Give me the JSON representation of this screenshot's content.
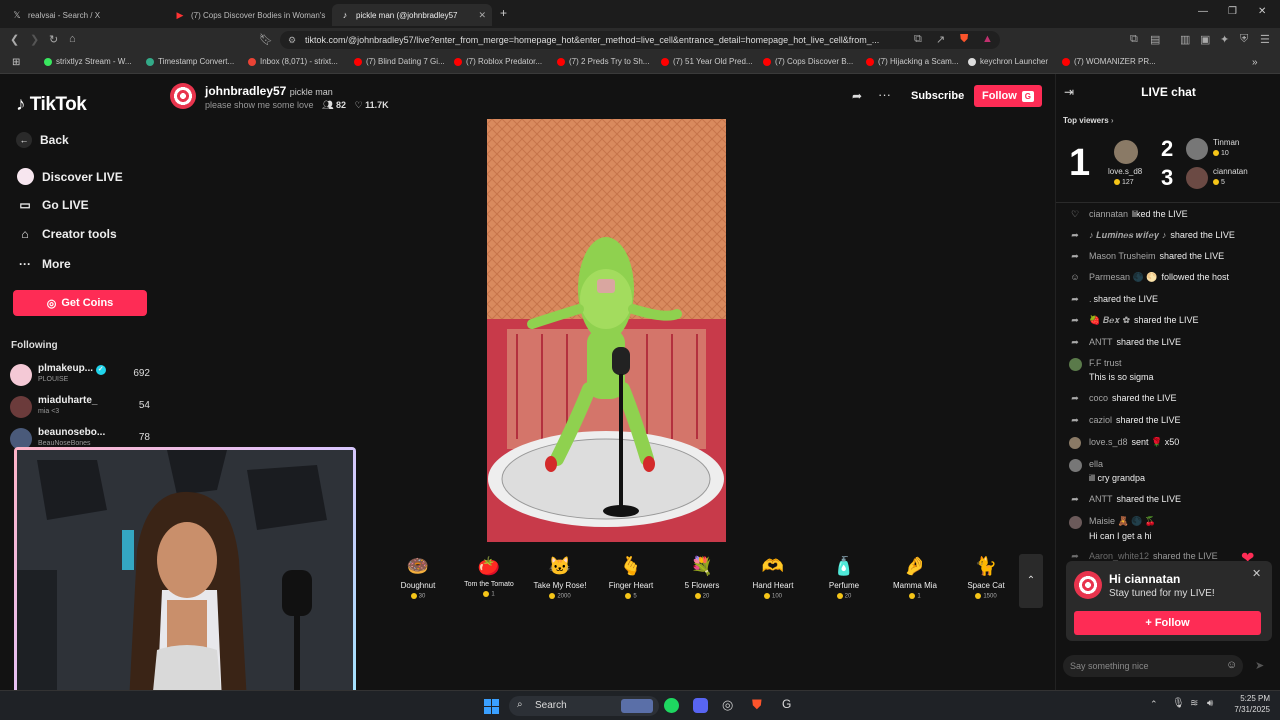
{
  "browser": {
    "tabs": [
      {
        "label": "realvsai - Search / X",
        "icon": "x-logo-icon"
      },
      {
        "label": "(7) Cops Discover Bodies in Woman's",
        "icon": "youtube-icon"
      },
      {
        "label": "pickle man (@johnbradley57",
        "icon": "tiktok-icon",
        "active": true
      }
    ],
    "url": "tiktok.com/@johnbradley57/live?enter_from_merge=homepage_hot&enter_method=live_cell&entrance_detail=homepage_hot_live_cell&from_...",
    "bookmarks": [
      "strixtlyz Stream - W...",
      "Timestamp Convert...",
      "Inbox (8,071) - strixt...",
      "(7) Blind Dating 7 Gi...",
      "(7) Roblox Predator...",
      "(7) 2 Preds Try to Sh...",
      "(7) 51 Year Old Pred...",
      "(7) Cops Discover B...",
      "(7) Hijacking a Scam...",
      "keychron Launcher",
      "(7) WOMANIZER PR..."
    ]
  },
  "sidebar": {
    "logo": "TikTok",
    "nav": [
      {
        "label": "Back",
        "icon": "arrow-left-icon"
      },
      {
        "label": "Discover LIVE",
        "icon": "live-circle-icon"
      },
      {
        "label": "Go LIVE",
        "icon": "video-camera-icon"
      },
      {
        "label": "Creator tools",
        "icon": "home-tools-icon"
      },
      {
        "label": "More",
        "icon": "more-dots-icon"
      }
    ],
    "get_coins": "Get Coins",
    "following_title": "Following",
    "following": [
      {
        "name": "plmakeup...",
        "sub": "PLOUISE",
        "count": "692",
        "verified": true
      },
      {
        "name": "miaduharte_",
        "sub": "mia <3",
        "count": "54"
      },
      {
        "name": "beaunosebo...",
        "sub": "BeauNoseBones",
        "count": "78"
      }
    ]
  },
  "live_header": {
    "username": "johnbradley57",
    "nickname": "pickle man",
    "description": "please show me some love",
    "viewers": "82",
    "likes": "11.7K",
    "subscribe": "Subscribe",
    "follow": "Follow",
    "follow_badge": "G"
  },
  "gifts": [
    {
      "name": "Doughnut",
      "price": "30",
      "icon": "🍩"
    },
    {
      "name": "Tom the Tomato",
      "price": "1",
      "icon": "🍅"
    },
    {
      "name": "Take My Rose!",
      "price": "2000",
      "icon": "🐱"
    },
    {
      "name": "Finger Heart",
      "price": "5",
      "icon": "🫰"
    },
    {
      "name": "5 Flowers",
      "price": "20",
      "icon": "💐"
    },
    {
      "name": "Hand Heart",
      "price": "100",
      "icon": "🫶"
    },
    {
      "name": "Perfume",
      "price": "20",
      "icon": "🧴"
    },
    {
      "name": "Mamma Mia",
      "price": "1",
      "icon": "🤌"
    },
    {
      "name": "Space Cat",
      "price": "1500",
      "icon": "🐈"
    }
  ],
  "chat": {
    "title": "LIVE chat",
    "top_viewers_label": "Top viewers",
    "top_viewers": [
      {
        "rank": "1",
        "name": "love.s_d8",
        "score": "127"
      },
      {
        "rank": "2",
        "name": "Tinman",
        "score": "10"
      },
      {
        "rank": "3",
        "name": "ciannatan",
        "score": "5"
      }
    ],
    "messages": [
      {
        "user": "ciannatan",
        "text": "liked the LIVE",
        "icon": "heart-outline-icon"
      },
      {
        "user": "♪ 𝑳𝒖𝒎𝒊𝒏𝒆𝒔 𝒘𝒊𝒇𝒆𝒚 ♪",
        "text": "shared the LIVE",
        "icon": "share-icon"
      },
      {
        "user": "Mason Trusheim",
        "text": "shared the LIVE",
        "icon": "share-icon"
      },
      {
        "user": "Parmesan 🌑 🌕",
        "text": "followed the host",
        "icon": "person-plus-icon"
      },
      {
        "user": ".",
        "text": "shared the LIVE",
        "icon": "share-icon"
      },
      {
        "user": "🍓 𝑩𝒆𝒙 ✿",
        "text": "shared the LIVE",
        "icon": "share-icon"
      },
      {
        "user": "ANTT",
        "text": "shared the LIVE",
        "icon": "share-icon"
      },
      {
        "user": "F.F trust",
        "text": "This is so sigma",
        "icon": "avatar-icon",
        "block": true
      },
      {
        "user": "coco",
        "text": "shared the LIVE",
        "icon": "share-icon"
      },
      {
        "user": "caziol",
        "text": "shared the LIVE",
        "icon": "share-icon"
      },
      {
        "user": "love.s_d8",
        "text": "sent 🌹 x50",
        "icon": "avatar-icon"
      },
      {
        "user": "ella",
        "text": "ill cry grandpa",
        "icon": "avatar-icon",
        "block": true
      },
      {
        "user": "ANTT",
        "text": "shared the LIVE",
        "icon": "share-icon"
      },
      {
        "user": "Maisie 🧸 🌑 🍒",
        "text": "Hi can I get a hi",
        "icon": "avatar-icon",
        "block": true
      },
      {
        "user": "Aaron_white12",
        "text": "shared the LIVE",
        "icon": "share-icon"
      }
    ],
    "popup": {
      "title": "Hi ciannatan",
      "subtitle": "Stay tuned for my LIVE!",
      "button": "+ Follow"
    },
    "input_placeholder": "Say something nice"
  },
  "taskbar": {
    "search": "Search",
    "time": "5:25 PM",
    "date": "7/31/2025"
  },
  "colors": {
    "accent": "#fe2c55",
    "background": "#121212"
  }
}
